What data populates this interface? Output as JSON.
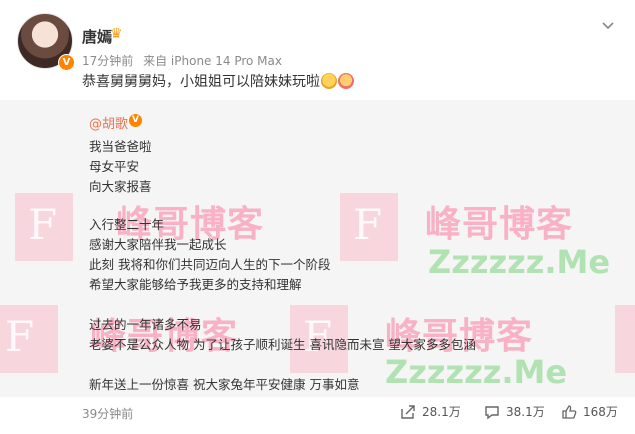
{
  "header": {
    "username": "唐嫣",
    "time": "17分钟前",
    "source": "来自 iPhone 14 Pro Max",
    "verified_badge": "V"
  },
  "post": {
    "text": "恭喜舅舅舅妈，小姐姐可以陪妹妹玩啦"
  },
  "repost": {
    "author": "@胡歌",
    "verified_badge": "V",
    "lines": [
      "我当爸爸啦",
      "母女平安",
      "向大家报喜",
      "入行整二十年",
      "感谢大家陪伴我一起成长",
      "此刻 我将和你们共同迈向人生的下一个阶段",
      "希望大家能够给予我更多的支持和理解",
      "过去的一年诸多不易",
      "老婆不是公众人物 为了让孩子顺利诞生 喜讯隐而未宣 望大家多多包涵",
      "新年送上一份惊喜 祝大家兔年平安健康 万事如意"
    ],
    "time": "39分钟前",
    "share_count": "28.1万",
    "comment_count": "38.1万",
    "like_count": "168万"
  },
  "watermark": {
    "letter": "F",
    "cn": "峰哥博客",
    "en": "Zzzzzz.Me"
  },
  "colors": {
    "accent_orange": "#ff8200",
    "card_bg": "#f5f5f5"
  }
}
